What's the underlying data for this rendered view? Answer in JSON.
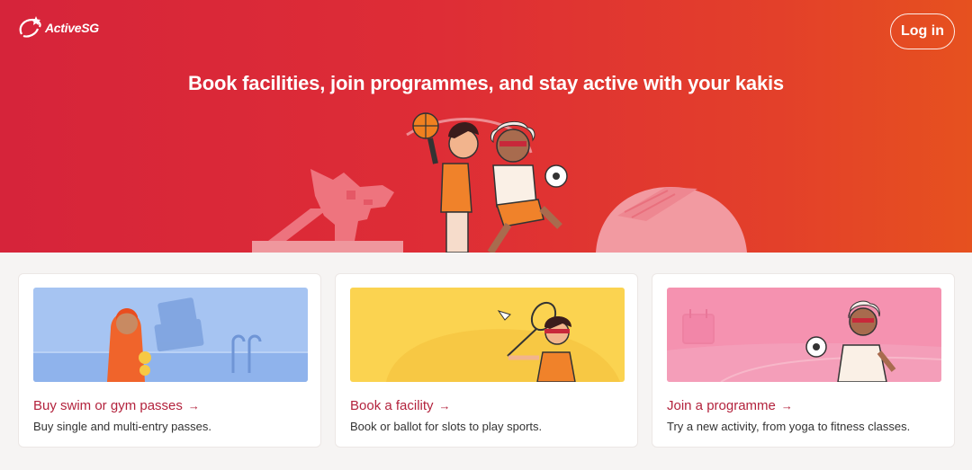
{
  "header": {
    "logo_text": "ActiveSG",
    "login_label": "Log in"
  },
  "hero": {
    "title": "Book facilities, join programmes, and stay active with your kakis",
    "background_colors": [
      "#d6243a",
      "#e6511f"
    ]
  },
  "cards": [
    {
      "title": "Buy swim or gym passes",
      "description": "Buy single and multi-entry passes.",
      "image_bg": "#a6c4f2",
      "icon": "arrow-right-icon"
    },
    {
      "title": "Book a facility",
      "description": "Book or ballot for slots to play sports.",
      "image_bg": "#fbd350",
      "icon": "arrow-right-icon"
    },
    {
      "title": "Join a programme",
      "description": "Try a new activity, from yoga to fitness classes.",
      "image_bg": "#f592b0",
      "icon": "arrow-right-icon"
    }
  ],
  "colors": {
    "accent": "#b3233d",
    "page_bg": "#f6f4f3"
  }
}
